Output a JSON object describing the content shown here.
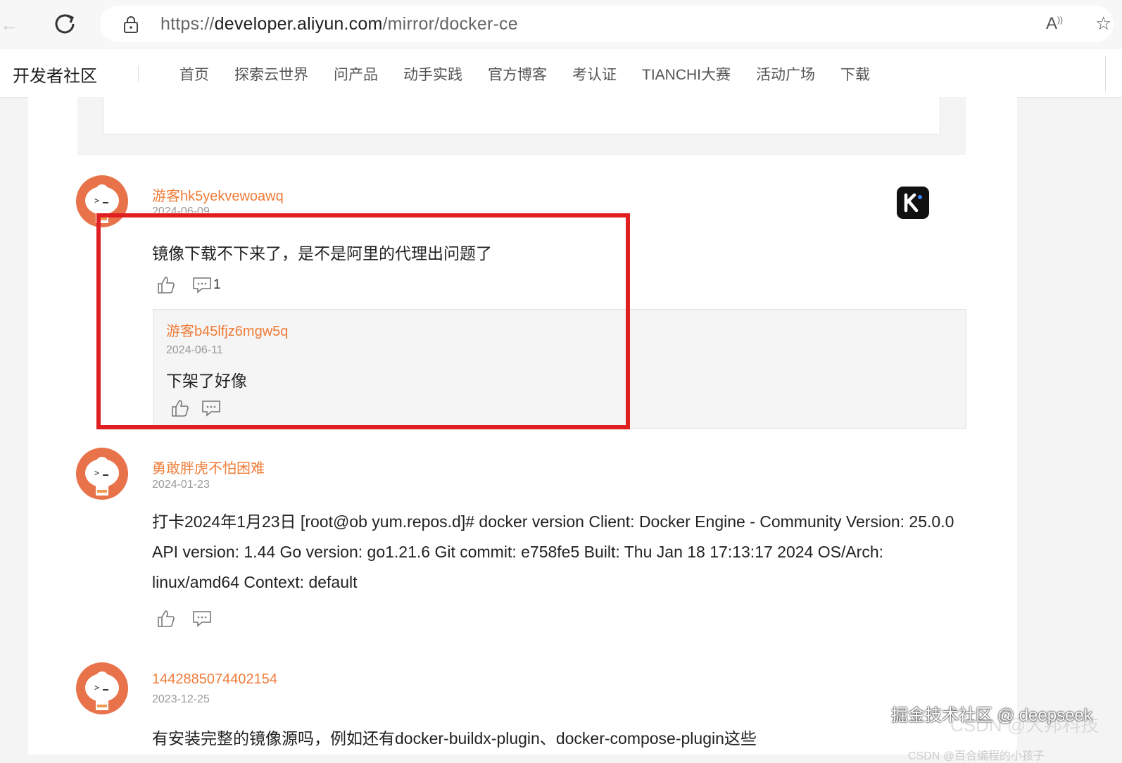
{
  "browser": {
    "url_prefix": "https://",
    "url_host": "developer.aliyun.com",
    "url_path": "/mirror/docker-ce"
  },
  "site": {
    "brand": "开发者社区",
    "nav": [
      "首页",
      "探索云世界",
      "问产品",
      "动手实践",
      "官方博客",
      "考认证",
      "TIANCHI大赛",
      "活动广场",
      "下载"
    ]
  },
  "comments": [
    {
      "user": "游客hk5yekvewoawq",
      "date": "2024-06-09",
      "text": "镜像下载不下来了，是不是阿里的代理出问题了",
      "reply_count": "1",
      "replies": [
        {
          "user": "游客b45lfjz6mgw5q",
          "date": "2024-06-11",
          "text": "下架了好像"
        }
      ]
    },
    {
      "user": "勇敢胖虎不怕困难",
      "date": "2024-01-23",
      "text": "打卡2024年1月23日 [root@ob yum.repos.d]# docker version Client: Docker Engine - Community Version: 25.0.0 API version: 1.44 Go version: go1.21.6 Git commit: e758fe5 Built: Thu Jan 18 17:13:17 2024 OS/Arch: linux/amd64 Context: default"
    },
    {
      "user": "1442885074402154",
      "date": "2023-12-25",
      "text": "有安装完整的镜像源吗，例如还有docker-buildx-plugin、docker-compose-plugin这些"
    }
  ],
  "overlay": {
    "watermark": "掘金技术社区 @ deepseek",
    "watermark_faint": "CSDN @大邦科技",
    "cutoff_text": "CSDN @百合编程的小孩子"
  },
  "colors": {
    "username": "#f07c38",
    "highlight_frame": "#e02020"
  }
}
